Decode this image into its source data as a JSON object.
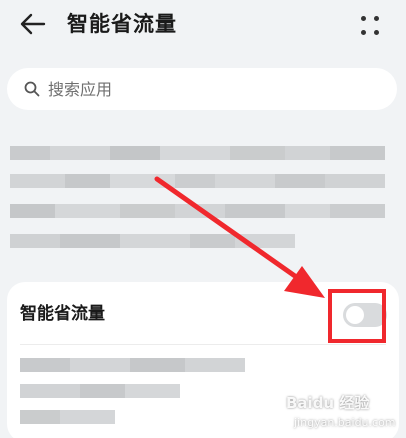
{
  "header": {
    "title": "智能省流量",
    "back_icon": "arrow-left-icon",
    "more_icon": "four-dots-icon"
  },
  "search": {
    "placeholder": "搜索应用",
    "icon": "search-icon"
  },
  "setting": {
    "label": "智能省流量",
    "toggle_on": false
  },
  "annotation": {
    "highlight_color": "#f0282d"
  },
  "watermark": {
    "main": "Baidu 经验",
    "sub": "jingyan.baidu.com"
  }
}
